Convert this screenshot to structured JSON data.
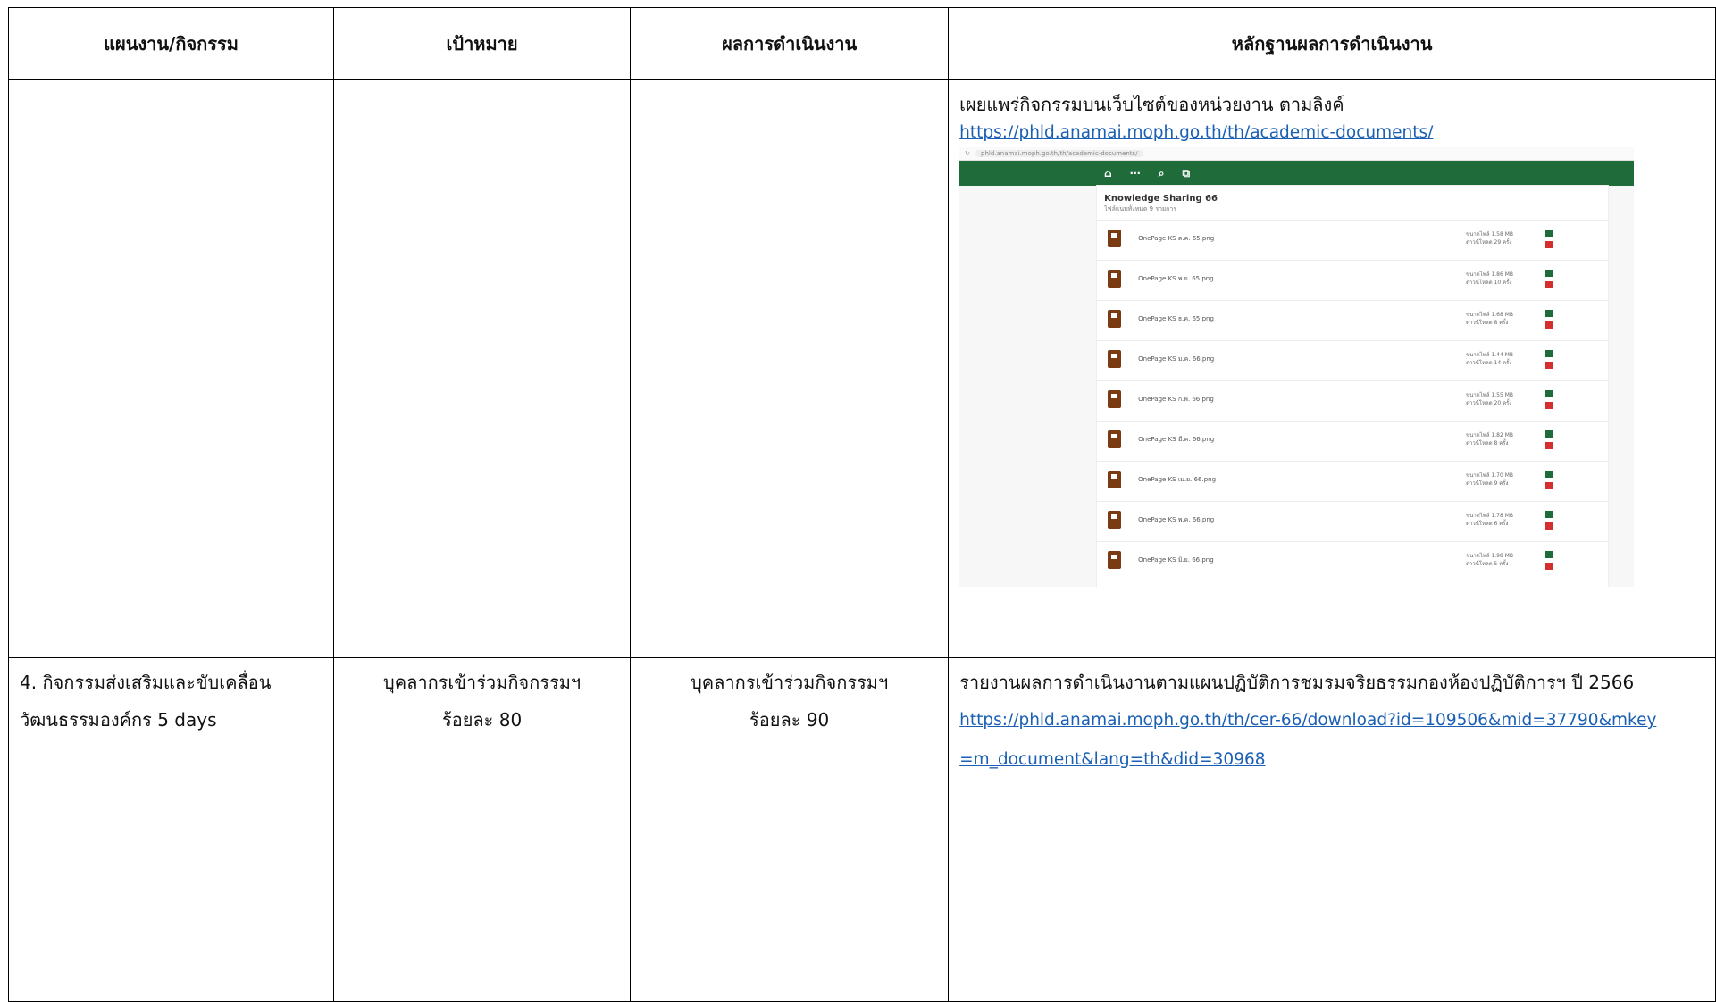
{
  "headers": {
    "plan": "แผนงาน/กิจกรรม",
    "target": "เป้าหมาย",
    "result": "ผลการดำเนินงาน",
    "evidence": "หลักฐานผลการดำเนินงาน"
  },
  "row1": {
    "evidence_text": "เผยแพร่กิจกรรมบนเว็บไซต์ของหน่วยงาน ตามลิงค์",
    "evidence_link": "https://phld.anamai.moph.go.th/th/academic-documents/",
    "screenshot": {
      "url": "phld.anamai.moph.go.th/th/academic-documents/",
      "panel_title": "Knowledge Sharing 66",
      "panel_subtitle": "ไฟล์แนบทั้งหมด 9 รายการ",
      "files": [
        {
          "name": "OnePage KS ต.ค. 65.png",
          "size": "ขนาดไฟล์ 1.58 MB",
          "downloads": "ดาวน์โหลด 29 ครั้ง"
        },
        {
          "name": "OnePage KS พ.ย. 65.png",
          "size": "ขนาดไฟล์ 1.86 MB",
          "downloads": "ดาวน์โหลด 10 ครั้ง"
        },
        {
          "name": "OnePage KS ธ.ค. 65.png",
          "size": "ขนาดไฟล์ 1.68 MB",
          "downloads": "ดาวน์โหลด 8 ครั้ง"
        },
        {
          "name": "OnePage KS ม.ค. 66.png",
          "size": "ขนาดไฟล์ 1.44 MB",
          "downloads": "ดาวน์โหลด 14 ครั้ง"
        },
        {
          "name": "OnePage KS ก.พ. 66.png",
          "size": "ขนาดไฟล์ 1.55 MB",
          "downloads": "ดาวน์โหลด 20 ครั้ง"
        },
        {
          "name": "OnePage KS มี.ค. 66.png",
          "size": "ขนาดไฟล์ 1.82 MB",
          "downloads": "ดาวน์โหลด 8 ครั้ง"
        },
        {
          "name": "OnePage KS เม.ย. 66.png",
          "size": "ขนาดไฟล์ 1.70 MB",
          "downloads": "ดาวน์โหลด 9 ครั้ง"
        },
        {
          "name": "OnePage KS พ.ค. 66.png",
          "size": "ขนาดไฟล์ 1.78 MB",
          "downloads": "ดาวน์โหลด 6 ครั้ง"
        },
        {
          "name": "OnePage KS มิ.ย. 66.png",
          "size": "ขนาดไฟล์ 1.98 MB",
          "downloads": "ดาวน์โหลด 5 ครั้ง"
        }
      ]
    }
  },
  "row2": {
    "plan": "4. กิจกรรมส่งเสริมและขับเคลื่อนวัฒนธรรมองค์กร 5 days",
    "target_line1": "บุคลากรเข้าร่วมกิจกรรมฯ",
    "target_line2": "ร้อยละ 80",
    "result_line1": "บุคลากรเข้าร่วมกิจกรรมฯ",
    "result_line2": "ร้อยละ 90",
    "evidence_text": "รายงานผลการดำเนินงานตามแผนปฏิบัติการชมรมจริยธรรมกองห้องปฏิบัติการฯ ปี 2566",
    "evidence_link": "https://phld.anamai.moph.go.th/th/cer-66/download?id=109506&mid=37790&mkey=m_document&lang=th&did=30968"
  }
}
